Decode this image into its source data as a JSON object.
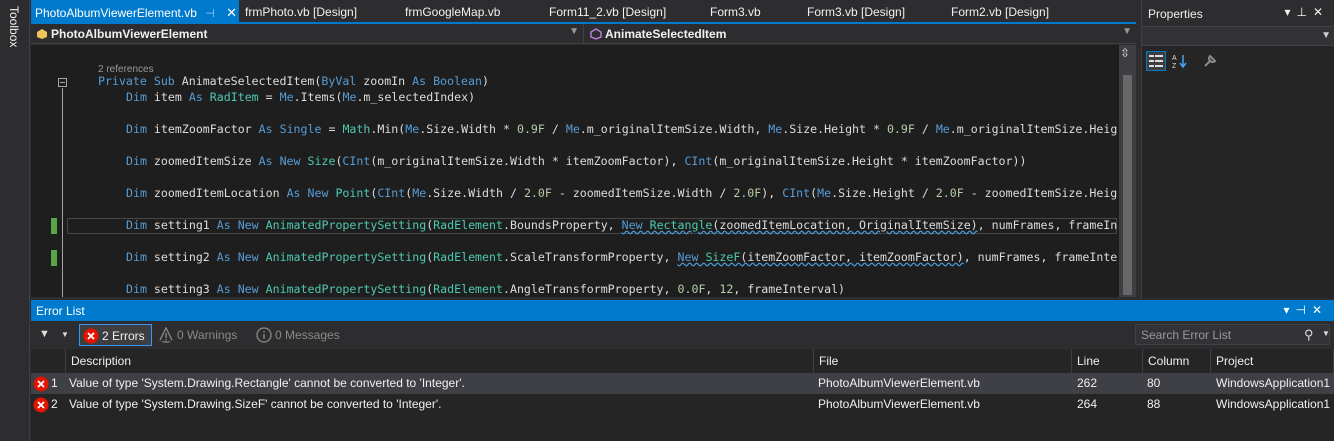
{
  "toolbox": {
    "label": "Toolbox"
  },
  "tabs": [
    {
      "label": "PhotoAlbumViewerElement.vb",
      "active": true
    },
    {
      "label": "frmPhoto.vb [Design]"
    },
    {
      "label": "frmGoogleMap.vb"
    },
    {
      "label": "Form11_2.vb [Design]"
    },
    {
      "label": "Form3.vb"
    },
    {
      "label": "Form3.vb [Design]"
    },
    {
      "label": "Form2.vb [Design]"
    }
  ],
  "navbar": {
    "class_name": "PhotoAlbumViewerElement",
    "member_name": "AnimateSelectedItem"
  },
  "editor": {
    "references": "2 references",
    "lines": [
      "Private Sub AnimateSelectedItem(ByVal zoomIn As Boolean)",
      "Dim item As RadItem = Me.Items(Me.m_selectedIndex)",
      "Dim itemZoomFactor As Single = Math.Min(Me.Size.Width * 0.9F / Me.m_originalItemSize.Width, Me.Size.Height * 0.9F / Me.m_originalItemSize.Heig",
      "Dim zoomedItemSize As New Size(CInt(m_originalItemSize.Width * itemZoomFactor), CInt(m_originalItemSize.Height * itemZoomFactor))",
      "Dim zoomedItemLocation As New Point(CInt(Me.Size.Width / 2.0F - zoomedItemSize.Width / 2.0F), CInt(Me.Size.Height / 2.0F - zoomedItemSize.Heig",
      "Dim setting1 As New AnimatedPropertySetting(RadElement.BoundsProperty, New Rectangle(zoomedItemLocation, OriginalItemSize), numFrames, frameIn",
      "Dim setting2 As New AnimatedPropertySetting(RadElement.ScaleTransformProperty, New SizeF(itemZoomFactor, itemZoomFactor), numFrames, frameInte",
      "Dim setting3 As New AnimatedPropertySetting(RadElement.AngleTransformProperty, 0.0F, 12, frameInterval)"
    ]
  },
  "properties": {
    "title": "Properties"
  },
  "error_list": {
    "title": "Error List",
    "errors_btn": "2 Errors",
    "warnings_btn": "0 Warnings",
    "messages_btn": "0 Messages",
    "search_placeholder": "Search Error List",
    "columns": [
      "Description",
      "File",
      "Line",
      "Column",
      "Project"
    ],
    "rows": [
      {
        "num": "1",
        "description": "Value of type 'System.Drawing.Rectangle' cannot be converted to 'Integer'.",
        "file": "PhotoAlbumViewerElement.vb",
        "line": "262",
        "column": "80",
        "project": "WindowsApplication1"
      },
      {
        "num": "2",
        "description": "Value of type 'System.Drawing.SizeF' cannot be converted to 'Integer'.",
        "file": "PhotoAlbumViewerElement.vb",
        "line": "264",
        "column": "88",
        "project": "WindowsApplication1"
      }
    ]
  },
  "colors": {
    "accent": "#007acc",
    "error": "#e51400",
    "editor_bg": "#1e1e1e",
    "change_marker": "#57a64a"
  }
}
